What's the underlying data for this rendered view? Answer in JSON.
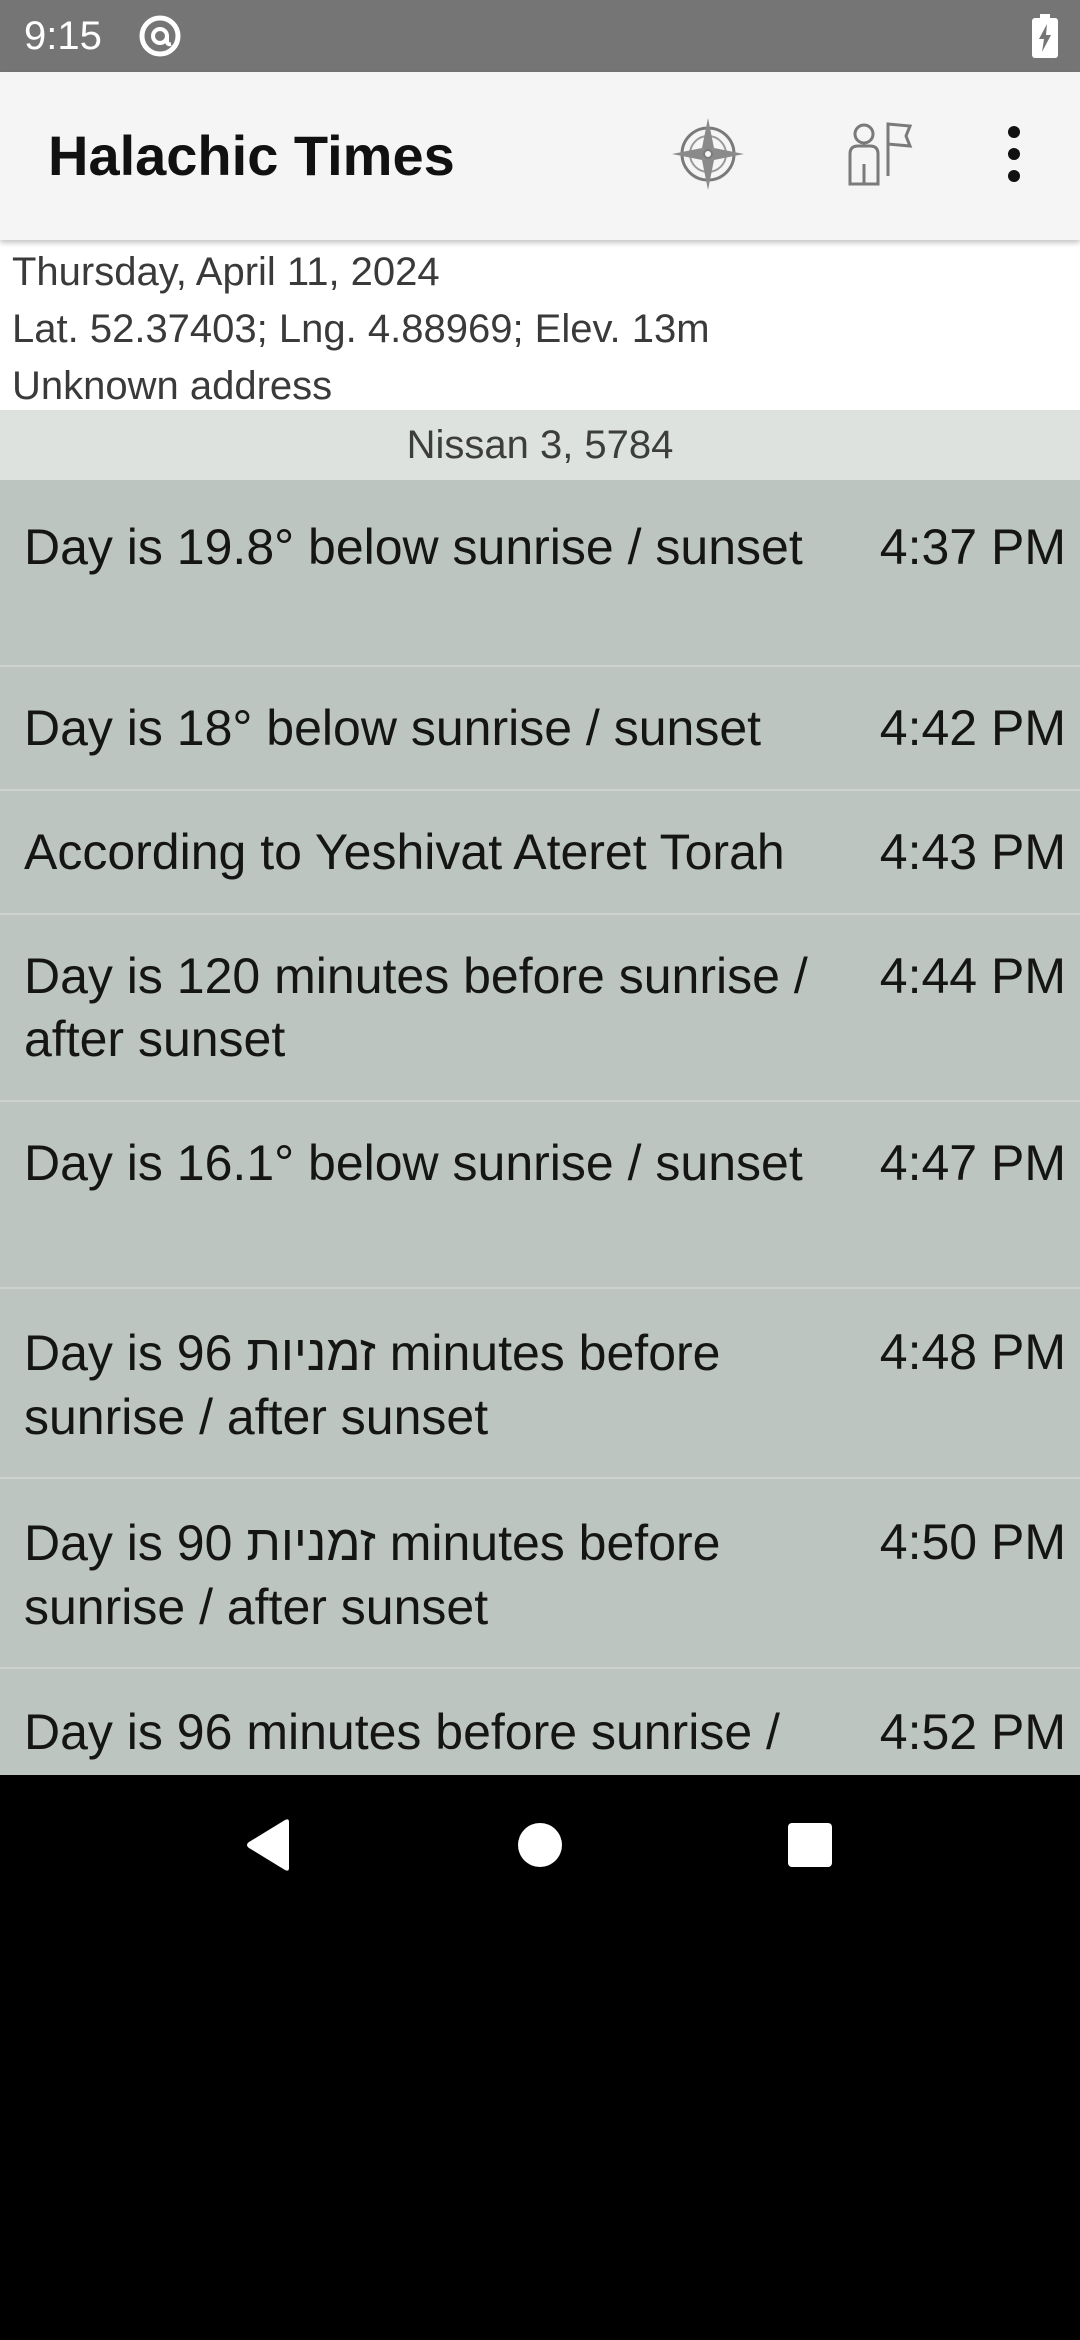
{
  "status_bar": {
    "time": "9:15",
    "icons": [
      "at-sign-icon",
      "battery-charging-icon"
    ]
  },
  "app_bar": {
    "title": "Halachic Times",
    "actions": [
      "location-compass-icon",
      "reminder-person-flag-icon",
      "overflow-menu-icon"
    ]
  },
  "header": {
    "date": "Thursday, April 11, 2024",
    "coordinates": "Lat. 52.37403; Lng. 4.88969; Elev. 13m",
    "address": "Unknown address",
    "hebrew_date": "Nissan 3, 5784"
  },
  "times": [
    {
      "label": "Day is 19.8° below sunrise / sunset",
      "time": "4:37 PM"
    },
    {
      "label": "Day is 18° below sunrise / sunset",
      "time": "4:42 PM"
    },
    {
      "label": "According to Yeshivat Ateret Torah",
      "time": "4:43 PM"
    },
    {
      "label": "Day is 120 minutes before sunrise / after sunset",
      "time": "4:44 PM"
    },
    {
      "label": "Day is 16.1° below sunrise / sunset",
      "time": "4:47 PM"
    },
    {
      "label": "Day is 96 זמניות minutes before sunrise / after sunset",
      "time": "4:48 PM"
    },
    {
      "label": "Day is 90 זמניות minutes before sunrise / after sunset",
      "time": "4:50 PM"
    },
    {
      "label": "Day is 96 minutes before sunrise /",
      "time": "4:52 PM"
    }
  ],
  "navigation": [
    "back-icon",
    "home-icon",
    "recents-icon"
  ],
  "colors": {
    "status_bar": "#757575",
    "app_bar": "#f5f5f5",
    "hebrew_date_bar": "#dde2df",
    "list_background": "#bcc5c0"
  }
}
